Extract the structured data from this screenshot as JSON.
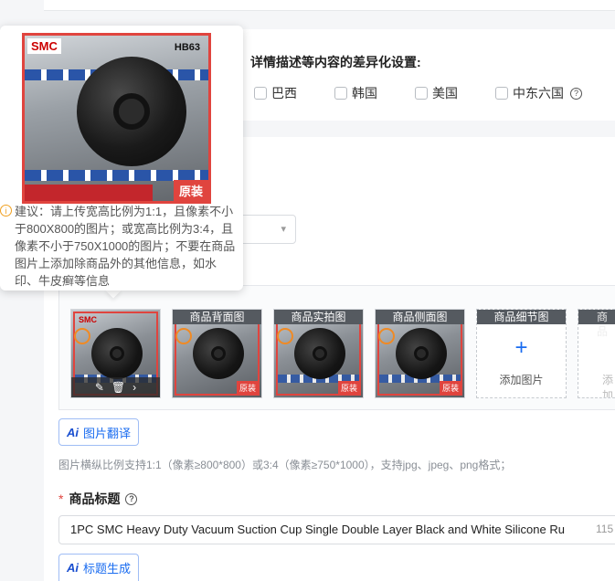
{
  "diff_settings": {
    "title": "详情描述等内容的差异化设置:",
    "countries": [
      "巴西",
      "韩国",
      "美国",
      "中东六国"
    ],
    "help_icon": "question-circle-icon"
  },
  "image_section": {
    "slots": [
      {
        "label": "",
        "filled": true,
        "photo_text": "SMC"
      },
      {
        "label": "商品背面图",
        "filled": true
      },
      {
        "label": "商品实拍图",
        "filled": true
      },
      {
        "label": "商品侧面图",
        "filled": true
      },
      {
        "label": "商品细节图",
        "filled": false,
        "add_text": "添加图片"
      },
      {
        "label": "商品",
        "filled": false,
        "add_text": "添加"
      }
    ],
    "photo_tag": "原装",
    "translate_button": "图片翻译",
    "hint": "图片横纵比例支持1:1（像素≥800*800）或3:4（像素≥750*1000），支持jpg、jpeg、png格式；"
  },
  "tooltip": {
    "text": "建议：请上传宽高比例为1:1，且像素不小于800X800的图片；或宽高比例为3:4，且像素不小于750X1000的图片；不要在商品图片上添加除商品外的其他信息，如水印、牛皮癣等信息",
    "photo_logo": "SMC",
    "photo_code": "HB63",
    "photo_tag": "原装"
  },
  "title_field": {
    "required_mark": "*",
    "label": "商品标题",
    "value": "1PC SMC Heavy Duty Vacuum Suction Cup Single Double Layer Black and White Silicone Ru",
    "count": "115",
    "ai_button": "标题生成"
  },
  "colors": {
    "accent": "#1a6cf0",
    "required": "#e0443e",
    "warning": "#f0a020"
  }
}
